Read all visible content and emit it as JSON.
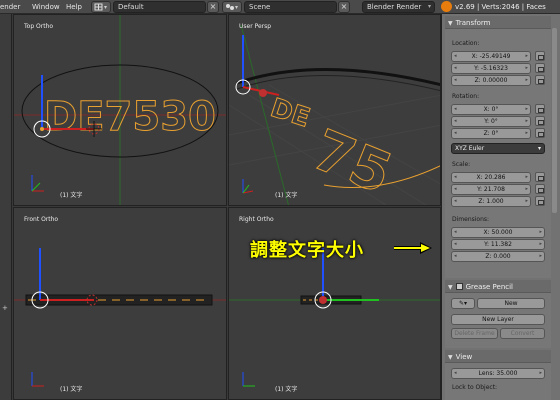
{
  "topbar": {
    "menus": [
      "ender",
      "Window",
      "Help"
    ],
    "layout_name": "Default",
    "scene_name": "Scene",
    "engine": "Blender Render",
    "stats": "v2.69 | Verts:2046 | Faces",
    "close_label": "×"
  },
  "viewports": {
    "top_left": {
      "title": "Top Ortho",
      "footer": "(1) 文字"
    },
    "top_right": {
      "title": "User Persp",
      "footer": "(1) 文字"
    },
    "bottom_left": {
      "title": "Front Ortho",
      "footer": "(1) 文字"
    },
    "bottom_right": {
      "title": "Right Ortho",
      "footer": "(1) 文字"
    }
  },
  "text_object": "DE7530",
  "panel": {
    "transform": {
      "title": "Transform",
      "location_label": "Location:",
      "location": [
        "X: -25.49149",
        "Y: -5.16323",
        "Z: 0.00000"
      ],
      "rotation_label": "Rotation:",
      "rotation": [
        "X: 0°",
        "Y: 0°",
        "Z: 0°"
      ],
      "rotation_mode": "XYZ Euler",
      "scale_label": "Scale:",
      "scale": [
        "X: 20.286",
        "Y: 21.708",
        "Z: 1.000"
      ],
      "dimensions_label": "Dimensions:",
      "dimensions": [
        "X: 50.000",
        "Y: 11.382",
        "Z: 0.000"
      ]
    },
    "grease_pencil": {
      "title": "Grease Pencil",
      "new_label": "New",
      "new_layer_label": "New Layer",
      "delete_frame_label": "Delete Frame",
      "convert_label": "Convert"
    },
    "view": {
      "title": "View",
      "lens": "Lens: 35.000",
      "lock_label": "Lock to Object:"
    }
  },
  "annotation": {
    "text": "調整文字大小",
    "color": "#ffff00"
  },
  "colors": {
    "text_outline": "#e8a030",
    "x_axis": "#cc2020",
    "y_axis": "#20c020",
    "z_axis": "#2050ff"
  }
}
